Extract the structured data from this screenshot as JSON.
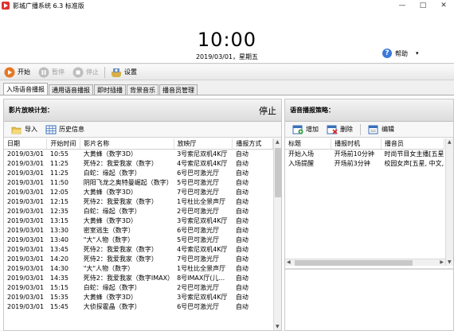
{
  "window": {
    "title": "影城广播系统 6.3 标准版",
    "controls": [
      "—",
      "□",
      "✕"
    ]
  },
  "clock": {
    "time": "10:00",
    "date": "2019/03/01，星期五"
  },
  "help": {
    "label": "帮助",
    "caret": "▾"
  },
  "toolbar": [
    {
      "label": "开始",
      "enabled": true,
      "icon": "play-icon",
      "color": "#e87722"
    },
    {
      "label": "暂停",
      "enabled": false,
      "icon": "pause-icon",
      "color": "#b8b8b8"
    },
    {
      "label": "停止",
      "enabled": false,
      "icon": "stop-icon",
      "color": "#b8b8b8"
    },
    {
      "label": "设置",
      "enabled": true,
      "icon": "settings-icon",
      "color": "#c8a040"
    }
  ],
  "tabs": [
    "入场语音播报",
    "通用语音播报",
    "即时插播",
    "背景音乐",
    "播音员管理"
  ],
  "active_tab": 0,
  "left": {
    "title": "影片放映计划：",
    "status": "停止",
    "tools": [
      {
        "label": "导入",
        "icon": "folder-open-icon"
      },
      {
        "label": "历史信息",
        "icon": "grid-icon"
      }
    ],
    "columns": [
      "日期",
      "开始时间",
      "影片名称",
      "放映厅",
      "播报方式"
    ],
    "rows": [
      [
        "2019/03/01",
        "10:55",
        "大黄蜂（数字3D）",
        "3号索尼双机4K厅",
        "自动"
      ],
      [
        "2019/03/01",
        "11:25",
        "死侍2：我爱我家（数字）",
        "4号索尼双机4K厅",
        "自动"
      ],
      [
        "2019/03/01",
        "11:25",
        "白蛇：缘起（数字）",
        "6号巴可激光厅",
        "自动"
      ],
      [
        "2019/03/01",
        "11:50",
        "阴阳飞龙之奥特曼崛起（数字）",
        "5号巴可激光厅",
        "自动"
      ],
      [
        "2019/03/01",
        "12:05",
        "大黄蜂（数字3D）",
        "7号巴可激光厅",
        "自动"
      ],
      [
        "2019/03/01",
        "12:15",
        "死侍2：我爱我家（数字）",
        "1号杜比全景声厅",
        "自动"
      ],
      [
        "2019/03/01",
        "12:35",
        "白蛇：缘起（数字）",
        "2号巴可激光厅",
        "自动"
      ],
      [
        "2019/03/01",
        "13:15",
        "大黄蜂（数字3D）",
        "3号索尼双机4K厅",
        "自动"
      ],
      [
        "2019/03/01",
        "13:30",
        "密室逃生（数字）",
        "6号巴可激光厅",
        "自动"
      ],
      [
        "2019/03/01",
        "13:40",
        "\"大\"人物（数字）",
        "5号巴可激光厅",
        "自动"
      ],
      [
        "2019/03/01",
        "13:45",
        "死侍2：我爱我家（数字）",
        "4号索尼双机4K厅",
        "自动"
      ],
      [
        "2019/03/01",
        "14:20",
        "死侍2：我爱我家（数字）",
        "7号巴可激光厅",
        "自动"
      ],
      [
        "2019/03/01",
        "14:30",
        "\"大\"人物（数字）",
        "1号杜比全景声厅",
        "自动"
      ],
      [
        "2019/03/01",
        "14:35",
        "死侍2：我爱我家（数字IMAX）",
        "8号IMAX厅(儿...",
        "自动"
      ],
      [
        "2019/03/01",
        "15:15",
        "白蛇：缘起（数字）",
        "2号巴可激光厅",
        "自动"
      ],
      [
        "2019/03/01",
        "15:35",
        "大黄蜂（数字3D）",
        "3号索尼双机4K厅",
        "自动"
      ],
      [
        "2019/03/01",
        "15:45",
        "大侦探霍晶（数字）",
        "6号巴可激光厅",
        "自动"
      ]
    ]
  },
  "right": {
    "title": "语音播报策略：",
    "tools": [
      {
        "label": "增加",
        "icon": "add-icon"
      },
      {
        "label": "删除",
        "icon": "delete-icon"
      },
      {
        "label": "编辑",
        "icon": "edit-icon"
      }
    ],
    "columns": [
      "标题",
      "播报时机",
      "播音员"
    ],
    "rows": [
      [
        "开始入场",
        "开场前10分钟",
        "时尚节目女主播[五星"
      ],
      [
        "入场提醒",
        "开场前3分钟",
        "校园女声[五星, 中文,"
      ]
    ]
  }
}
